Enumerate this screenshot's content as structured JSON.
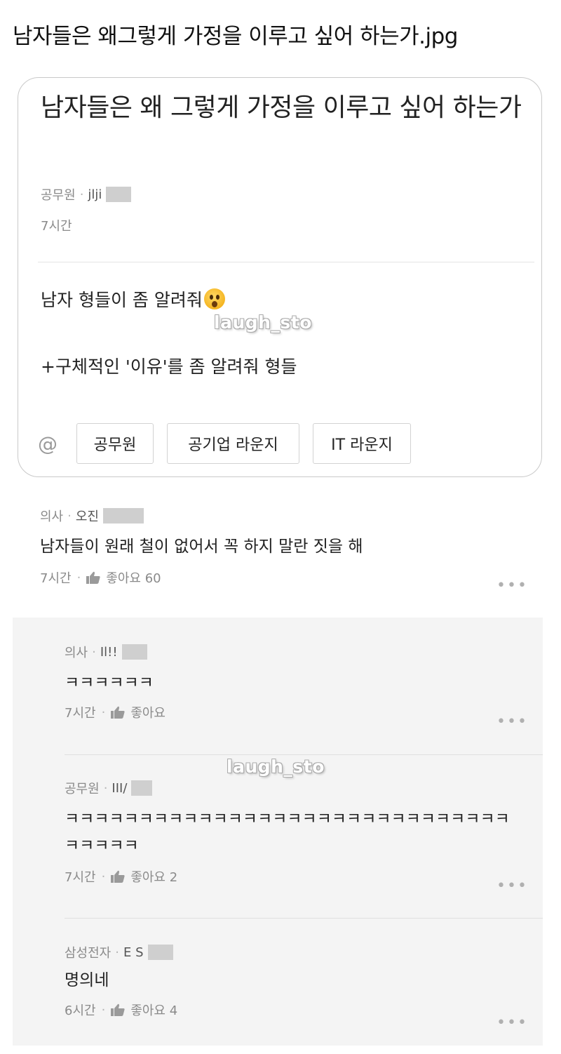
{
  "page_title": "남자들은 왜그렇게 가정을 이루고 싶어 하는가.jpg",
  "post": {
    "title": "남자들은 왜 그렇게 가정을 이루고 싶어 하는가",
    "author_company": "공무원",
    "author_handle": "jlji",
    "time": "7시간",
    "body_line1": "남자 형들이 좀 알려줘",
    "emoji": "astonished-face-emoji",
    "body_line2": "+구체적인 '이유'를 좀 알려줘 형들",
    "tags": [
      "공무원",
      "공기업 라운지",
      "IT 라운지"
    ]
  },
  "watermark": "laugh_sto",
  "comments": [
    {
      "company": "의사",
      "handle": "오진",
      "text": "남자들이 원래 철이 없어서 꼭 하지 말란 짓을 해",
      "time": "7시간",
      "likes": "좋아요 60"
    }
  ],
  "replies": [
    {
      "company": "의사",
      "handle": "Il!!",
      "text": "ㅋㅋㅋㅋㅋㅋ",
      "time": "7시간",
      "likes": "좋아요"
    },
    {
      "company": "공무원",
      "handle": "III/",
      "text": "ㅋㅋㅋㅋㅋㅋㅋㅋㅋㅋㅋㅋㅋㅋㅋㅋㅋㅋㅋㅋㅋㅋㅋㅋㅋㅋㅋㅋㅋㅋㅋㅋㅋㅋㅋ",
      "time": "7시간",
      "likes": "좋아요 2"
    },
    {
      "company": "삼성전자",
      "handle": "E S",
      "text": "명의네",
      "time": "6시간",
      "likes": "좋아요 4"
    }
  ],
  "icons": {
    "mention": "at-icon",
    "like": "thumbs-up-icon",
    "more": "more-dots-icon"
  },
  "colors": {
    "muted_text": "#8a8a8a",
    "reply_background": "#f4f4f4",
    "card_border": "#c9c9c9"
  }
}
